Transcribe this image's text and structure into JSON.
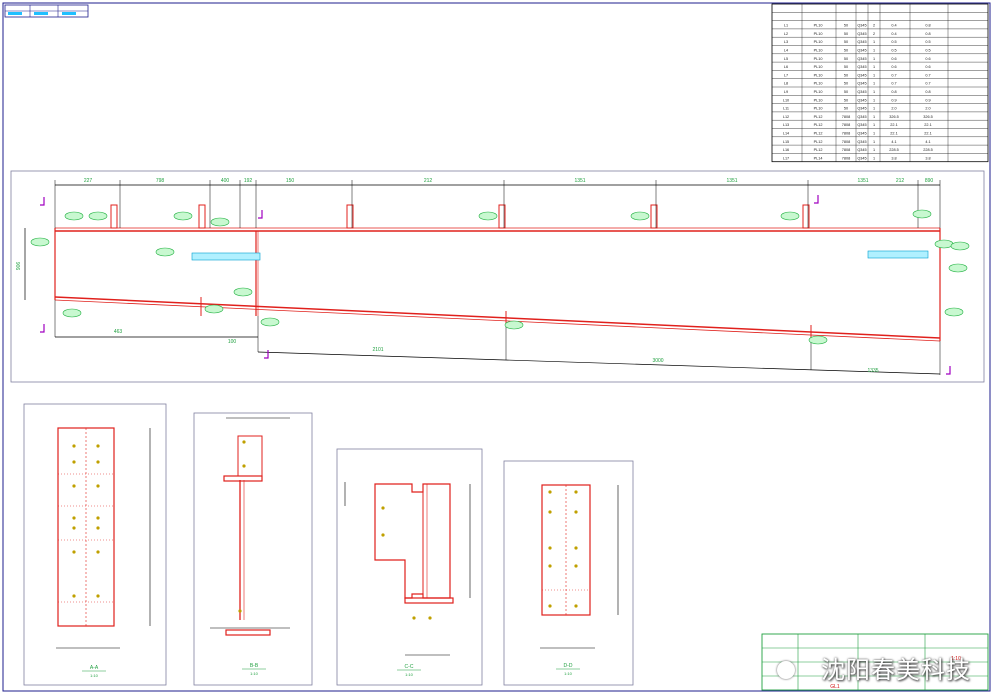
{
  "drawing": {
    "parts_table": {
      "headers": [
        "",
        "",
        "",
        "",
        "",
        "",
        ""
      ],
      "rows": [
        [
          "L1",
          "PL10",
          "50",
          "Q345",
          "2",
          "0.4",
          "0.8"
        ],
        [
          "L2",
          "PL10",
          "50",
          "Q345",
          "2",
          "0.4",
          "0.8"
        ],
        [
          "L3",
          "PL10",
          "50",
          "Q345",
          "1",
          "0.5",
          "0.5"
        ],
        [
          "L4",
          "PL10",
          "50",
          "Q345",
          "1",
          "0.5",
          "0.5"
        ],
        [
          "L5",
          "PL10",
          "50",
          "Q345",
          "1",
          "0.6",
          "0.6"
        ],
        [
          "L6",
          "PL10",
          "50",
          "Q345",
          "1",
          "0.6",
          "0.6"
        ],
        [
          "L7",
          "PL10",
          "50",
          "Q345",
          "1",
          "0.7",
          "0.7"
        ],
        [
          "L8",
          "PL10",
          "50",
          "Q345",
          "1",
          "0.7",
          "0.7"
        ],
        [
          "L9",
          "PL10",
          "50",
          "Q345",
          "1",
          "0.8",
          "0.8"
        ],
        [
          "L10",
          "PL10",
          "50",
          "Q345",
          "1",
          "0.9",
          "0.9"
        ],
        [
          "L11",
          "PL10",
          "50",
          "Q345",
          "1",
          "2.0",
          "2.0"
        ],
        [
          "L12",
          "PL12",
          "7808",
          "Q345",
          "1",
          "326.5",
          "326.5"
        ],
        [
          "L13",
          "PL12",
          "7808",
          "Q345",
          "1",
          "22.1",
          "22.1"
        ],
        [
          "L14",
          "PL12",
          "7808",
          "Q345",
          "1",
          "22.1",
          "22.1"
        ],
        [
          "L15",
          "PL12",
          "7808",
          "Q345",
          "1",
          "4.1",
          "4.1"
        ],
        [
          "L16",
          "PL12",
          "7808",
          "Q345",
          "1",
          "228.5",
          "228.5"
        ],
        [
          "L17",
          "PL14",
          "7808",
          "Q345",
          "1",
          "3.8",
          "3.8"
        ]
      ]
    },
    "top_dims": [
      "227",
      "798",
      "400",
      "192",
      "150",
      "212",
      "1351",
      "1351",
      "1351",
      "890",
      "212"
    ],
    "bottom_dims": [
      "463",
      "100",
      "2101",
      "3000",
      "1335"
    ],
    "left_dim": "906",
    "section_views": [
      {
        "caption": "A-A",
        "scale": "1:10"
      },
      {
        "caption": "B-B",
        "scale": "1:10"
      },
      {
        "caption": "C-C",
        "scale": "1:10"
      },
      {
        "caption": "D-D",
        "scale": "1:10"
      }
    ],
    "title_block": {
      "project": "",
      "code": "GL1",
      "scale": "1:10"
    }
  },
  "watermark": {
    "text": "沈阳春美科技",
    "icon": "wechat-icon"
  },
  "colors": {
    "frame": "#1d1d8c",
    "steel": "#e0201c",
    "dimension": "#000000",
    "label_bg": "#c8f8d0",
    "label_border": "#20b040",
    "marker": "#a000c0",
    "highlight_label": "#00c8ff"
  }
}
